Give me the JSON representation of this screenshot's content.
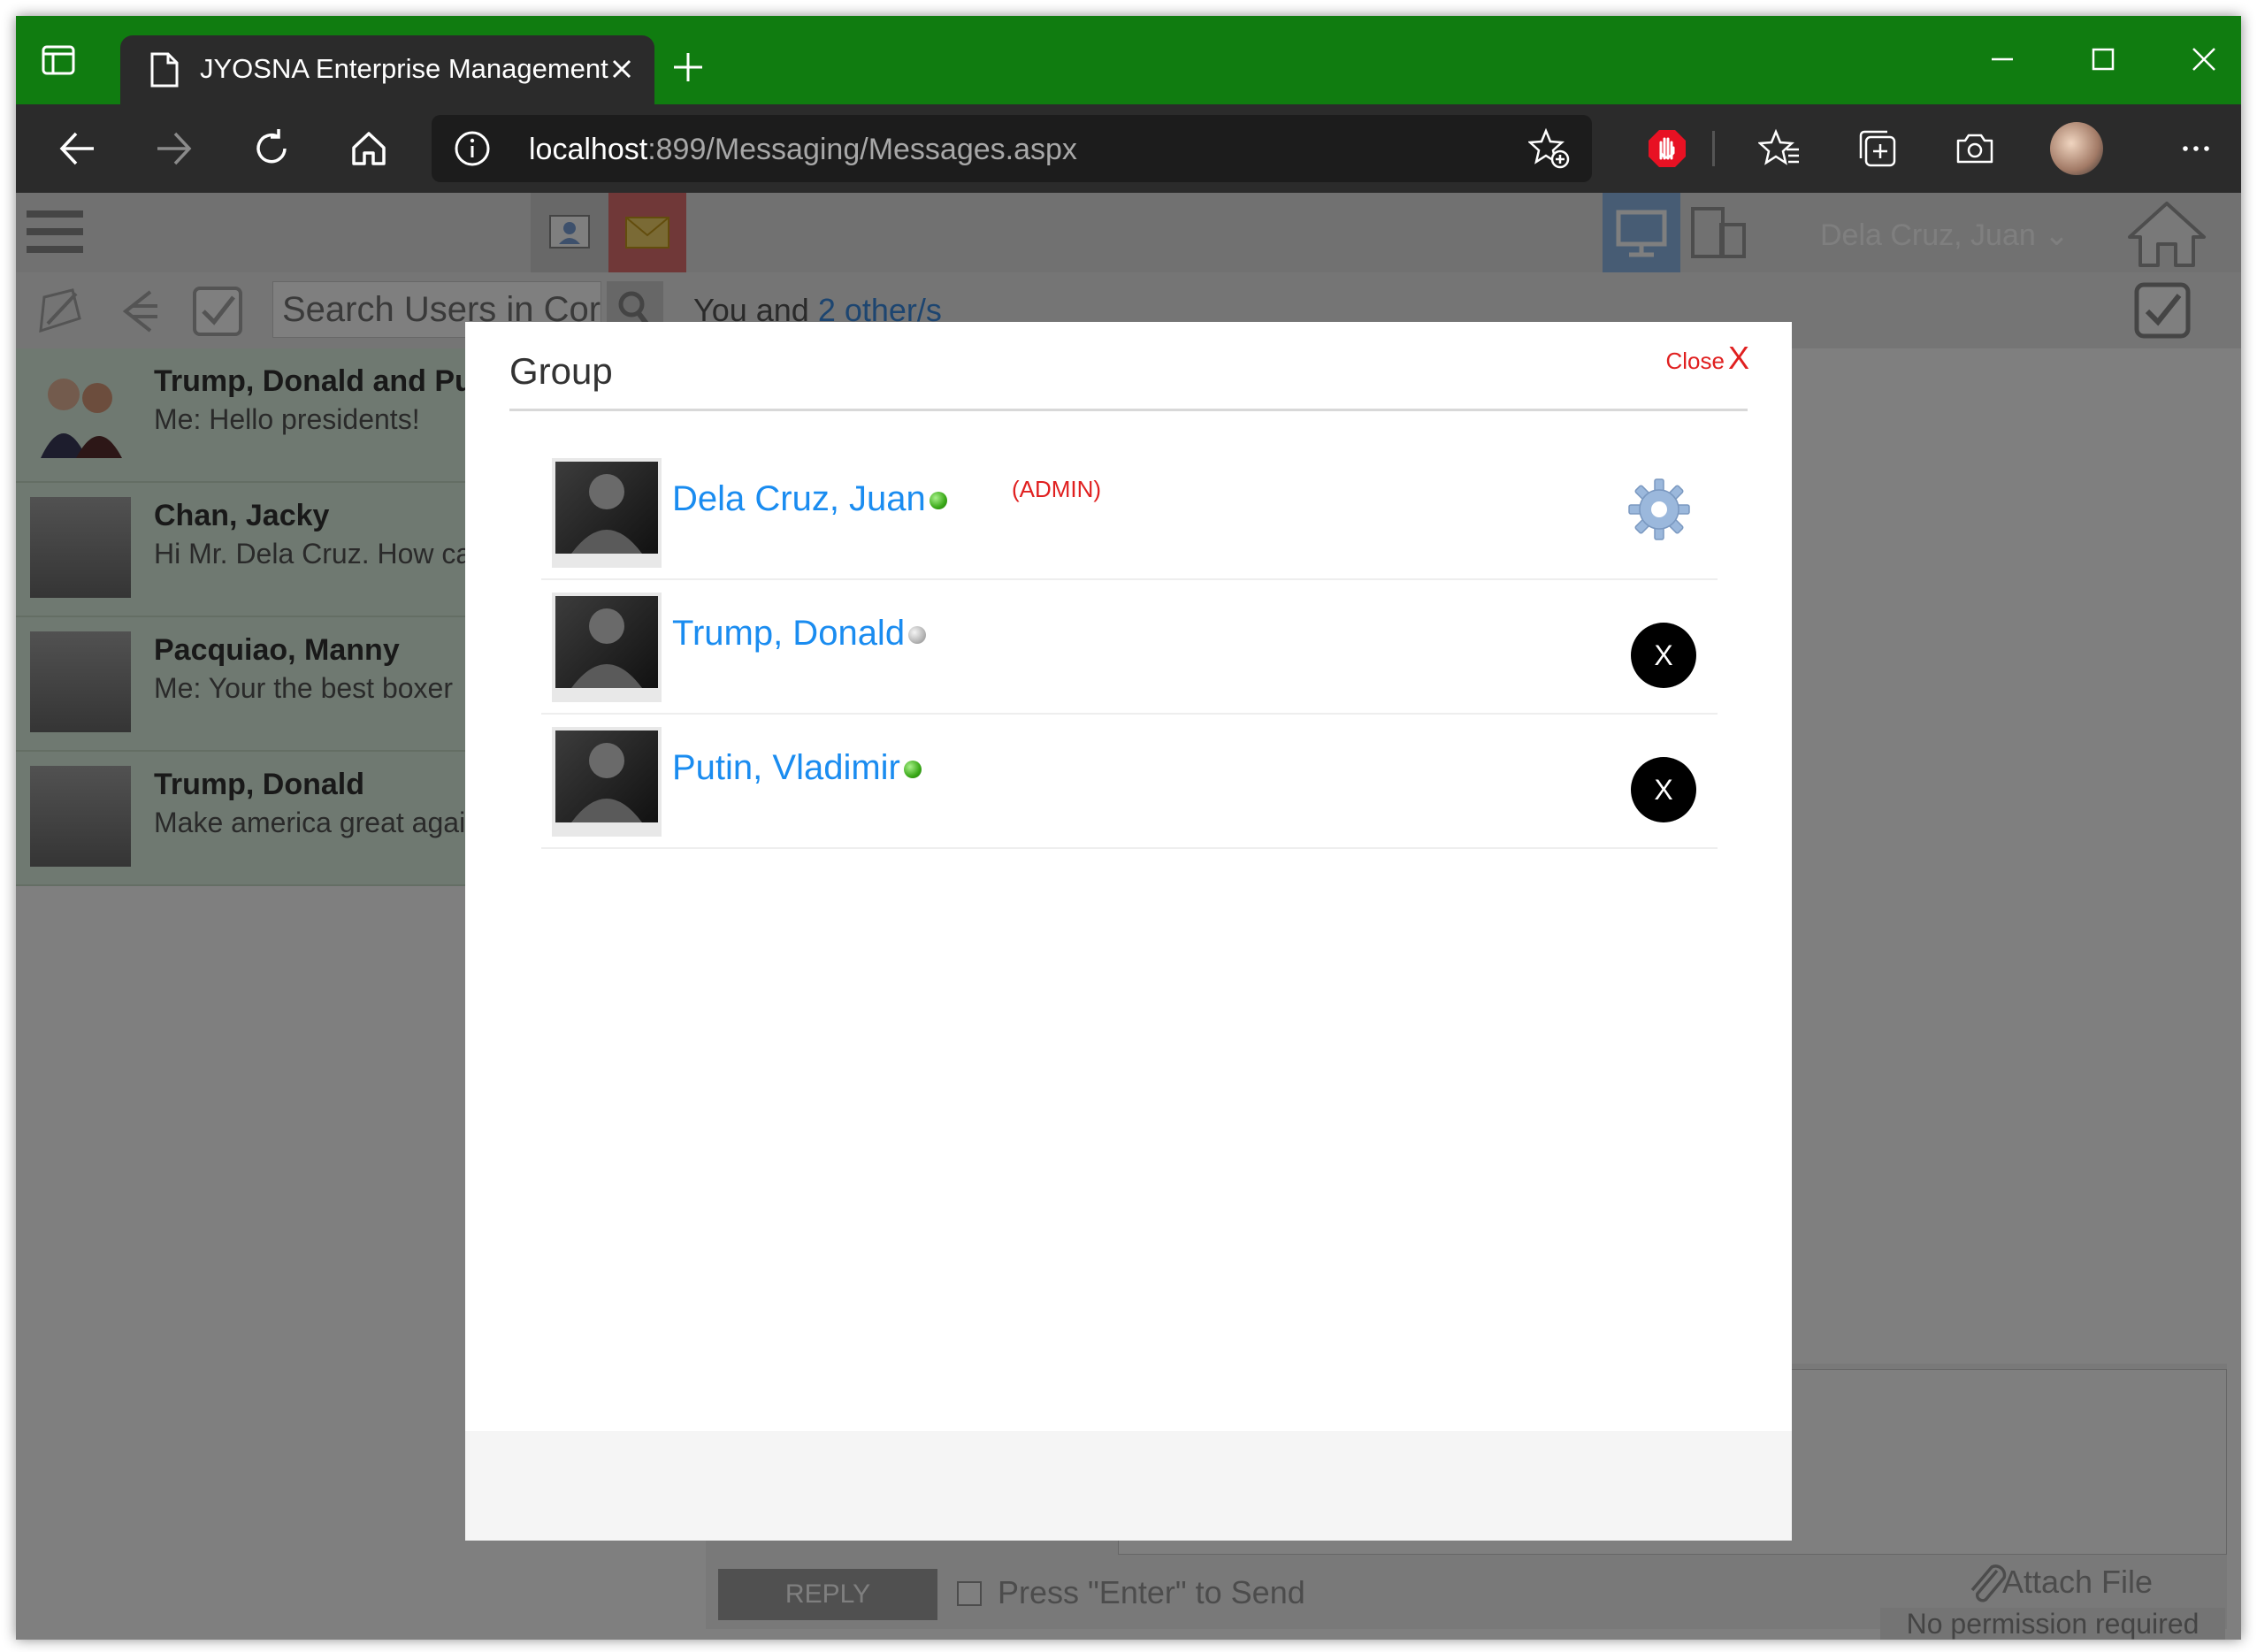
{
  "browser": {
    "tab_title": "JYOSNA Enterprise Management",
    "address_host": "localhost",
    "address_path": ":899/Messaging/Messages.aspx"
  },
  "app": {
    "user_name": "Dela Cruz, Juan",
    "search_placeholder": "Search Users in Cor",
    "header_prefix": "You and ",
    "header_link": "2 other/s",
    "reply_label": "REPLY",
    "enter_to_send_label": "Press \"Enter\" to Send",
    "attach_label": "Attach File",
    "no_permission": "No permission required",
    "conversations": [
      {
        "name": "Trump, Donald and Put",
        "snippet": "Me: Hello presidents!"
      },
      {
        "name": "Chan, Jacky",
        "snippet": "Hi Mr. Dela Cruz. How ca"
      },
      {
        "name": "Pacquiao, Manny",
        "snippet": "Me: Your the best boxer"
      },
      {
        "name": "Trump, Donald",
        "snippet": "Make america great agai"
      }
    ]
  },
  "modal": {
    "title": "Group",
    "close_label": "Close",
    "close_x": "X",
    "members": [
      {
        "name": "Dela Cruz, Juan",
        "status": "online",
        "badge": "(ADMIN)",
        "action": "settings"
      },
      {
        "name": "Trump, Donald",
        "status": "offline",
        "badge": "",
        "action": "X"
      },
      {
        "name": "Putin, Vladimir",
        "status": "online",
        "badge": "",
        "action": "X"
      }
    ]
  },
  "colors": {
    "tabbar": "#107c10",
    "link": "#1a8cf0",
    "admin": "#e02020"
  }
}
